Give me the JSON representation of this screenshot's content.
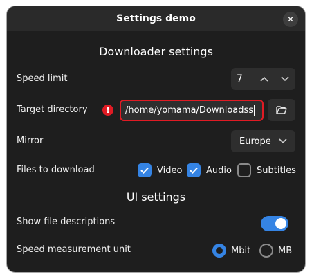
{
  "window": {
    "title": "Settings demo"
  },
  "downloader": {
    "heading": "Downloader settings",
    "speed_limit": {
      "label": "Speed limit",
      "value": "7"
    },
    "target_directory": {
      "label": "Target directory",
      "value": "/home/yomama/Downloadss",
      "error": true
    },
    "mirror": {
      "label": "Mirror",
      "selected": "Europe"
    },
    "files": {
      "label": "Files to download",
      "options": [
        {
          "label": "Video",
          "checked": true
        },
        {
          "label": "Audio",
          "checked": true
        },
        {
          "label": "Subtitles",
          "checked": false
        }
      ]
    }
  },
  "ui": {
    "heading": "UI settings",
    "file_descriptions": {
      "label": "Show file descriptions",
      "on": true
    },
    "speed_unit": {
      "label": "Speed measurement unit",
      "options": [
        {
          "label": "Mbit",
          "selected": true
        },
        {
          "label": "MB",
          "selected": false
        }
      ]
    }
  },
  "colors": {
    "accent": "#3584e4",
    "error": "#e01b24",
    "background": "#1e1e1e",
    "titlebar": "#2a2a2a"
  }
}
